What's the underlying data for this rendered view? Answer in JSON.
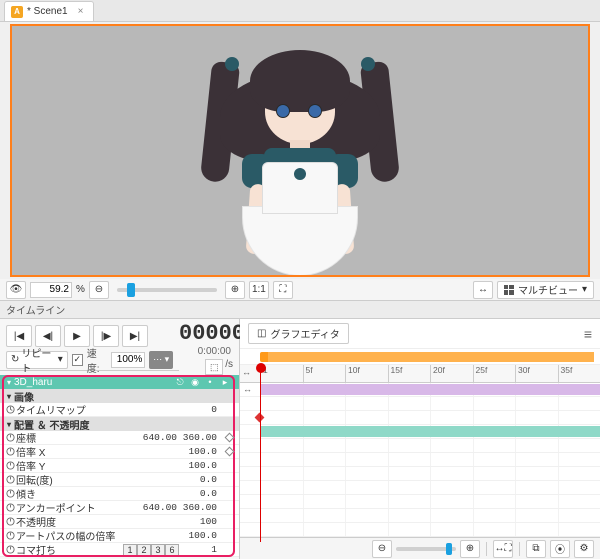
{
  "tab": {
    "title": "* Scene1"
  },
  "viewport_toolbar": {
    "zoom_value": "59.2",
    "percent": "%",
    "fit_label": "1:1",
    "multiview_label": "マルチビュー"
  },
  "timeline": {
    "header_label": "タイムライン",
    "frame": "00000",
    "subframe": "0:00:00",
    "repeat_label": "リピート",
    "speed_label": "速度:",
    "speed_value": "100%",
    "per_sec": "/s"
  },
  "graph_editor": {
    "label": "グラフエディタ"
  },
  "ruler_ticks": [
    "1",
    "5f",
    "10f",
    "15f",
    "20f",
    "25f",
    "30f",
    "35f"
  ],
  "object": {
    "name": "3D_haru"
  },
  "groups": {
    "image": "画像",
    "transform": "配置 ＆ 不透明度"
  },
  "props": {
    "timeremap": {
      "label": "タイムリマップ",
      "v1": "",
      "v2": "0"
    },
    "position": {
      "label": "座標",
      "v1": "640.00",
      "v2": "360.00"
    },
    "scalex": {
      "label": "倍率 X",
      "v1": "",
      "v2": "100.0"
    },
    "scaley": {
      "label": "倍率 Y",
      "v1": "",
      "v2": "100.0"
    },
    "rotation": {
      "label": "回転(度)",
      "v1": "",
      "v2": "0.0"
    },
    "skew": {
      "label": "傾き",
      "v1": "",
      "v2": "0.0"
    },
    "anchor": {
      "label": "アンカーポイント",
      "v1": "640.00",
      "v2": "360.00"
    },
    "opacity": {
      "label": "不透明度",
      "v1": "",
      "v2": "100"
    },
    "artpath": {
      "label": "アートパスの幅の倍率",
      "v1": "",
      "v2": "100.0"
    },
    "koma": {
      "label": "コマ打ち",
      "v1": "",
      "v2": "1"
    }
  },
  "koma_buttons": [
    "1",
    "2",
    "3",
    "6"
  ]
}
